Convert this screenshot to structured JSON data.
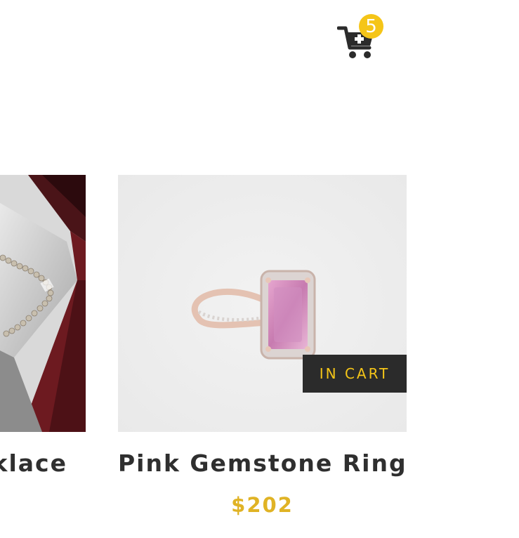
{
  "header": {
    "cart": {
      "icon": "shopping-cart-plus-icon",
      "count": "5",
      "badge_color": "#f5c518"
    }
  },
  "products": [
    {
      "name": "klace",
      "image": "pearl-necklace-in-box-photo"
    },
    {
      "name": "Pink Gemstone Ring",
      "price": "$202",
      "image": "pink-gemstone-ring-photo",
      "cart_button_label": "IN CART"
    }
  ],
  "colors": {
    "accent": "#f5c518",
    "price": "#e0b325",
    "button_bg": "#2b2b2b",
    "text": "#2f2f2f"
  }
}
